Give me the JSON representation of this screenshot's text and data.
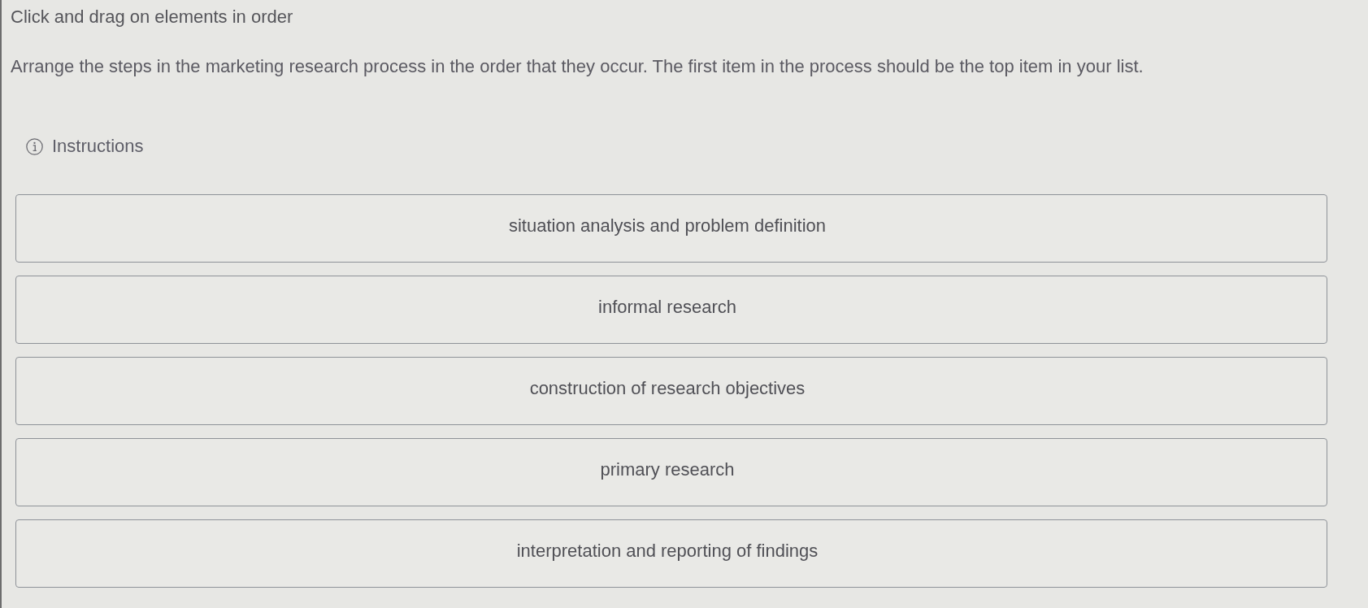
{
  "prompt": {
    "heading": "Click and drag on elements in order",
    "question": "Arrange the steps in the marketing research process in the order that they occur. The first item in the process should be the top item in your list.",
    "instructions_link": "Instructions"
  },
  "items": [
    "situation analysis and problem definition",
    "informal research",
    "construction of research objectives",
    "primary research",
    "interpretation and reporting of findings"
  ]
}
